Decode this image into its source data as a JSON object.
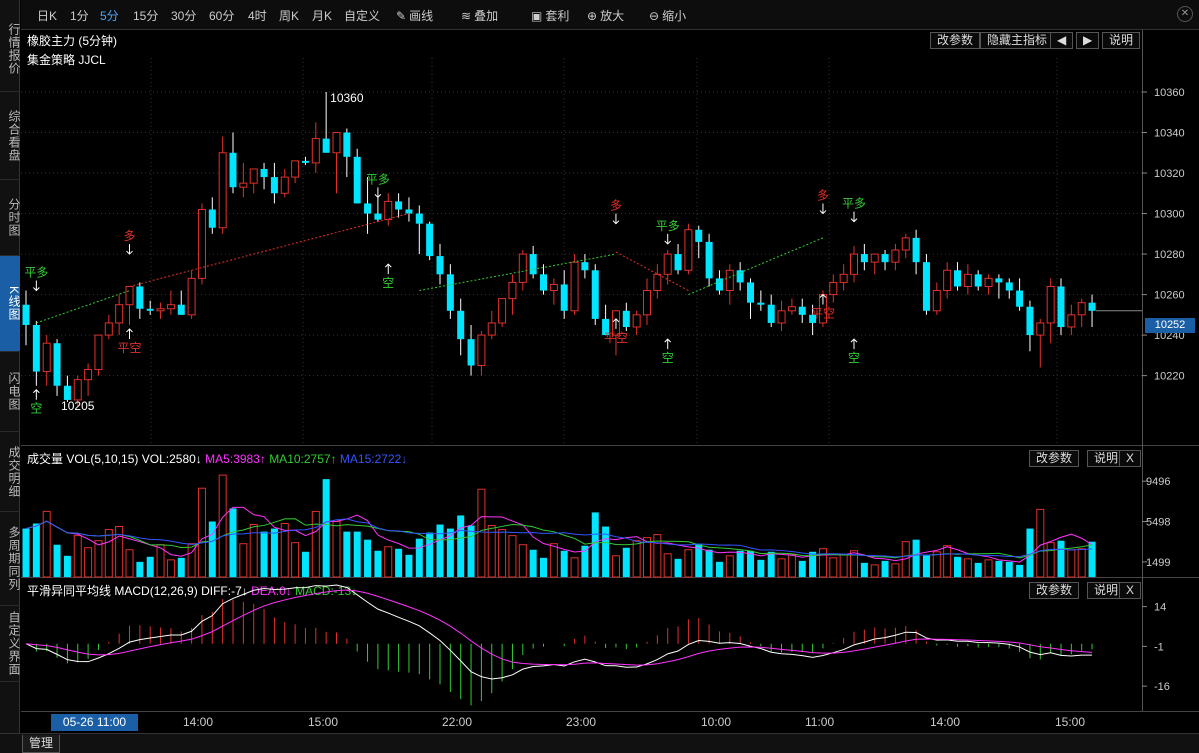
{
  "sidebar": {
    "items": [
      {
        "label": "行情报价"
      },
      {
        "label": "综合看盘"
      },
      {
        "label": "分时图"
      },
      {
        "label": "K线图"
      },
      {
        "label": "闪电图"
      },
      {
        "label": "成交明细"
      },
      {
        "label": "多周期同列"
      },
      {
        "label": "自定义界面"
      }
    ]
  },
  "toolbar": {
    "periods": [
      "日K",
      "1分",
      "5分",
      "15分",
      "30分",
      "60分",
      "4时",
      "周K",
      "月K",
      "自定义"
    ],
    "active_period": "5分",
    "draw": "画线",
    "overlay": "叠加",
    "arbitrage": "套利",
    "zoom_in": "放大",
    "zoom_out": "缩小",
    "close": "✕"
  },
  "main_panel": {
    "title": "橡胶主力 (5分钟)",
    "strategy": "集金策略 JJCL",
    "btn_params": "改参数",
    "btn_hide": "隐藏主指标",
    "btn_left": "◀",
    "btn_right": "▶",
    "btn_help": "说明",
    "y_ticks": [
      "10360",
      "10340",
      "10320",
      "10300",
      "10280",
      "10260",
      "10240",
      "10220"
    ],
    "current_price": "10252",
    "high_label": "10360",
    "low_label": "10205",
    "signals": [
      "平多",
      "空",
      "多",
      "平空",
      "平多",
      "空",
      "多",
      "平空",
      "平多",
      "空",
      "平空",
      "多",
      "平多",
      "平空",
      "空"
    ]
  },
  "vol_panel": {
    "title": "成交量",
    "params": "VOL(5,10,15)",
    "vol": "VOL:2580↓",
    "ma5": "MA5:3983↑",
    "ma10": "MA10:2757↑",
    "ma15": "MA15:2722↓",
    "btn_params": "改参数",
    "btn_help": "说明",
    "btn_close": "X",
    "y_ticks": [
      "9496",
      "5498",
      "1499"
    ]
  },
  "macd_panel": {
    "title": "平滑异同平均线",
    "params": "MACD(12,26,9)",
    "diff": "DIFF:-7↓",
    "dea": "DEA:0↓",
    "macd": "MACD:-13↓",
    "btn_params": "改参数",
    "btn_help": "说明",
    "btn_close": "X",
    "y_ticks": [
      "14",
      "-1",
      "-16"
    ]
  },
  "time_axis": {
    "cursor": "05-26 11:00",
    "labels": [
      "14:00",
      "15:00",
      "22:00",
      "23:00",
      "10:00",
      "11:00",
      "14:00",
      "15:00"
    ]
  },
  "bottom": {
    "manage": "管理"
  },
  "colors": {
    "up": "#e0312b",
    "down": "#00e5ff",
    "ma5": "#ff33ff",
    "ma10": "#33cc33",
    "ma15": "#3355ff",
    "signal_long": "#e0312b",
    "signal_close": "#33cc33",
    "accent": "#1a5fa6"
  },
  "chart_data": {
    "type": "candlestick",
    "y_range": [
      10205,
      10360
    ],
    "candles": [
      [
        10255,
        10262,
        10235,
        10245
      ],
      [
        10245,
        10247,
        10215,
        10222
      ],
      [
        10222,
        10240,
        10215,
        10236
      ],
      [
        10236,
        10238,
        10210,
        10215
      ],
      [
        10215,
        10220,
        10207,
        10208
      ],
      [
        10208,
        10220,
        10205,
        10218
      ],
      [
        10218,
        10226,
        10210,
        10223
      ],
      [
        10223,
        10240,
        10220,
        10240
      ],
      [
        10240,
        10250,
        10238,
        10246
      ],
      [
        10246,
        10260,
        10240,
        10255
      ],
      [
        10255,
        10262,
        10245,
        10264
      ],
      [
        10264,
        10266,
        10248,
        10253
      ],
      [
        10253,
        10257,
        10250,
        10252
      ],
      [
        10252,
        10256,
        10248,
        10253
      ],
      [
        10253,
        10262,
        10250,
        10255
      ],
      [
        10255,
        10262,
        10250,
        10250
      ],
      [
        10250,
        10272,
        10248,
        10268
      ],
      [
        10268,
        10305,
        10265,
        10302
      ],
      [
        10302,
        10308,
        10290,
        10293
      ],
      [
        10293,
        10338,
        10290,
        10330
      ],
      [
        10330,
        10340,
        10310,
        10313
      ],
      [
        10313,
        10325,
        10308,
        10315
      ],
      [
        10315,
        10322,
        10310,
        10322
      ],
      [
        10322,
        10325,
        10312,
        10318
      ],
      [
        10318,
        10325,
        10305,
        10310
      ],
      [
        10310,
        10322,
        10308,
        10318
      ],
      [
        10318,
        10325,
        10315,
        10326
      ],
      [
        10326,
        10328,
        10324,
        10325
      ],
      [
        10325,
        10345,
        10320,
        10337
      ],
      [
        10337,
        10360,
        10330,
        10330
      ],
      [
        10330,
        10335,
        10310,
        10340
      ],
      [
        10340,
        10342,
        10318,
        10328
      ],
      [
        10328,
        10332,
        10305,
        10305
      ],
      [
        10305,
        10318,
        10290,
        10300
      ],
      [
        10300,
        10308,
        10296,
        10297
      ],
      [
        10297,
        10310,
        10294,
        10306
      ],
      [
        10306,
        10310,
        10298,
        10302
      ],
      [
        10302,
        10308,
        10296,
        10300
      ],
      [
        10300,
        10304,
        10280,
        10295
      ],
      [
        10295,
        10296,
        10277,
        10279
      ],
      [
        10279,
        10285,
        10265,
        10270
      ],
      [
        10270,
        10275,
        10248,
        10252
      ],
      [
        10252,
        10258,
        10230,
        10238
      ],
      [
        10238,
        10245,
        10220,
        10225
      ],
      [
        10225,
        10242,
        10220,
        10240
      ],
      [
        10240,
        10252,
        10238,
        10246
      ],
      [
        10246,
        10258,
        10244,
        10258
      ],
      [
        10258,
        10270,
        10250,
        10266
      ],
      [
        10266,
        10282,
        10262,
        10280
      ],
      [
        10280,
        10284,
        10268,
        10270
      ],
      [
        10270,
        10275,
        10260,
        10262
      ],
      [
        10262,
        10268,
        10255,
        10265
      ],
      [
        10265,
        10272,
        10248,
        10252
      ],
      [
        10252,
        10280,
        10250,
        10276
      ],
      [
        10276,
        10280,
        10268,
        10272
      ],
      [
        10272,
        10275,
        10245,
        10248
      ],
      [
        10248,
        10255,
        10240,
        10240
      ],
      [
        10240,
        10250,
        10230,
        10252
      ],
      [
        10252,
        10256,
        10242,
        10244
      ],
      [
        10244,
        10252,
        10240,
        10250
      ],
      [
        10250,
        10268,
        10245,
        10262
      ],
      [
        10262,
        10275,
        10258,
        10270
      ],
      [
        10270,
        10282,
        10265,
        10280
      ],
      [
        10280,
        10285,
        10270,
        10272
      ],
      [
        10272,
        10295,
        10270,
        10292
      ],
      [
        10292,
        10294,
        10278,
        10286
      ],
      [
        10286,
        10290,
        10264,
        10268
      ],
      [
        10268,
        10272,
        10260,
        10262
      ],
      [
        10262,
        10275,
        10255,
        10272
      ],
      [
        10272,
        10276,
        10262,
        10266
      ],
      [
        10266,
        10268,
        10248,
        10256
      ],
      [
        10256,
        10262,
        10252,
        10255
      ],
      [
        10255,
        10260,
        10244,
        10246
      ],
      [
        10246,
        10257,
        10242,
        10252
      ],
      [
        10252,
        10258,
        10250,
        10254
      ],
      [
        10254,
        10258,
        10246,
        10250
      ],
      [
        10250,
        10255,
        10240,
        10246
      ],
      [
        10246,
        10262,
        10244,
        10260
      ],
      [
        10260,
        10270,
        10256,
        10266
      ],
      [
        10266,
        10275,
        10262,
        10270
      ],
      [
        10270,
        10284,
        10266,
        10280
      ],
      [
        10280,
        10285,
        10272,
        10276
      ],
      [
        10276,
        10280,
        10270,
        10280
      ],
      [
        10280,
        10282,
        10272,
        10276
      ],
      [
        10276,
        10285,
        10272,
        10282
      ],
      [
        10282,
        10290,
        10278,
        10288
      ],
      [
        10288,
        10292,
        10270,
        10276
      ],
      [
        10276,
        10280,
        10250,
        10252
      ],
      [
        10252,
        10266,
        10250,
        10262
      ],
      [
        10262,
        10276,
        10258,
        10272
      ],
      [
        10272,
        10276,
        10262,
        10264
      ],
      [
        10264,
        10275,
        10260,
        10270
      ],
      [
        10270,
        10272,
        10262,
        10264
      ],
      [
        10264,
        10270,
        10260,
        10268
      ],
      [
        10268,
        10270,
        10258,
        10266
      ],
      [
        10266,
        10268,
        10258,
        10262
      ],
      [
        10262,
        10268,
        10252,
        10254
      ],
      [
        10254,
        10257,
        10232,
        10240
      ],
      [
        10240,
        10248,
        10224,
        10246
      ],
      [
        10246,
        10268,
        10236,
        10264
      ],
      [
        10264,
        10268,
        10240,
        10244
      ],
      [
        10244,
        10255,
        10240,
        10250
      ],
      [
        10250,
        10258,
        10244,
        10256
      ],
      [
        10256,
        10260,
        10244,
        10252
      ]
    ],
    "volumes": [
      4800,
      5300,
      6500,
      3200,
      2100,
      4100,
      2900,
      3600,
      4700,
      5000,
      2700,
      1500,
      2000,
      3200,
      1700,
      1900,
      3300,
      8800,
      5500,
      10100,
      6800,
      3300,
      5200,
      4500,
      4800,
      5300,
      3400,
      2500,
      6500,
      9700,
      5500,
      4500,
      4500,
      3700,
      2600,
      3000,
      2800,
      2200,
      3800,
      4400,
      5200,
      4800,
      6100,
      5100,
      8700,
      5100,
      4700,
      4100,
      3200,
      2700,
      1900,
      3300,
      2600,
      1900,
      3100,
      6400,
      5000,
      2100,
      2900,
      3600,
      3900,
      4200,
      2300,
      1800,
      2700,
      3300,
      2700,
      1500,
      2100,
      2600,
      2600,
      1700,
      2500,
      1800,
      2200,
      1600,
      2500,
      2800,
      1900,
      2200,
      2600,
      1400,
      1200,
      1600,
      1300,
      3500,
      3700,
      2200,
      2500,
      3100,
      2000,
      1800,
      1400,
      1700,
      1600,
      1500,
      1200,
      4800,
      6700,
      3400,
      3600,
      2700,
      2800,
      3500
    ],
    "signals": [
      {
        "label": "平多",
        "index": 1,
        "price": 10262
      },
      {
        "label": "空",
        "index": 1,
        "price": 10215
      },
      {
        "label": "多",
        "index": 10,
        "price": 10280
      },
      {
        "label": "平空",
        "index": 10,
        "price": 10245
      },
      {
        "label": "平多",
        "index": 34,
        "price": 10308
      },
      {
        "label": "空",
        "index": 35,
        "price": 10277
      },
      {
        "label": "多",
        "index": 57,
        "price": 10295
      },
      {
        "label": "平空",
        "index": 57,
        "price": 10250
      },
      {
        "label": "平多",
        "index": 62,
        "price": 10285
      },
      {
        "label": "空",
        "index": 62,
        "price": 10240
      },
      {
        "label": "多",
        "index": 77,
        "price": 10300
      },
      {
        "label": "平空",
        "index": 77,
        "price": 10262
      },
      {
        "label": "平多",
        "index": 80,
        "price": 10296
      },
      {
        "label": "空",
        "index": 80,
        "price": 10240
      }
    ],
    "y_ticks": [
      10360,
      10340,
      10320,
      10300,
      10280,
      10260,
      10240,
      10220
    ],
    "vol_ticks": [
      9496,
      5498,
      1499
    ],
    "macd_ticks": [
      14,
      -1,
      -16
    ]
  }
}
